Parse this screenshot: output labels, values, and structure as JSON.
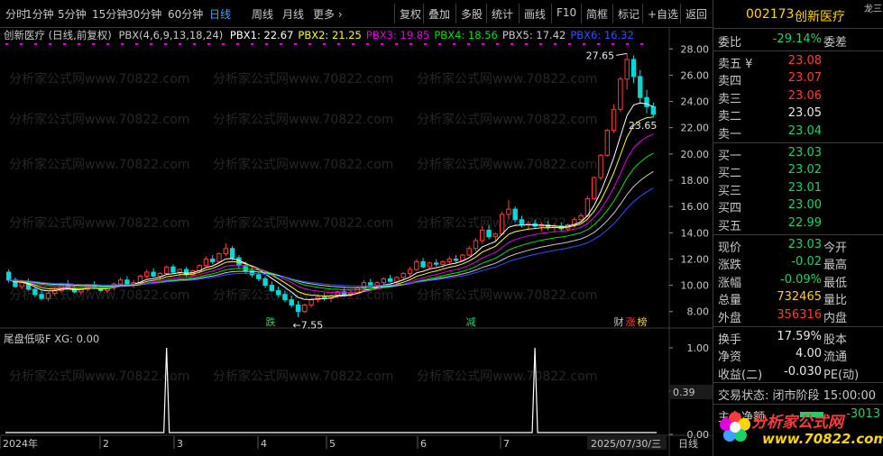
{
  "toolbar": {
    "periods": [
      "分时",
      "1分钟",
      "5分钟",
      "15分钟",
      "30分钟",
      "60分钟",
      "日线",
      "周线",
      "月线",
      "更多 ›"
    ],
    "active_period": "日线",
    "actions": [
      "复权",
      "叠加",
      "多股",
      "统计",
      "画线",
      "F10",
      "简框",
      "标记",
      "+自选",
      "返回"
    ]
  },
  "main_chart": {
    "title": "创新医疗 (日线,前复权)",
    "indicator_name": "PBX(4,6,9,13,18,24)",
    "indicators": [
      {
        "label": "PBX1: 22.67",
        "color": "#ffffff"
      },
      {
        "label": "PBX2: 21.25",
        "color": "#ffff00"
      },
      {
        "label": "PBX3: 19.85",
        "color": "#e000e0"
      },
      {
        "label": "PBX4: 18.56",
        "color": "#00e000"
      },
      {
        "label": "PBX5: 17.42",
        "color": "#c8c8c8"
      },
      {
        "label": "PBX6: 16.32",
        "color": "#3050ff"
      }
    ],
    "y_ticks": [
      "28.00",
      "26.00",
      "24.00",
      "22.00",
      "20.00",
      "18.00",
      "16.00",
      "14.00",
      "12.00",
      "10.00",
      "8.00"
    ],
    "high_label": "27.65",
    "close_label": "23.65",
    "low_label": "←7.55",
    "markers": [
      {
        "text": "跌",
        "color": "#19d36a"
      },
      {
        "text": "减",
        "color": "#19d36a"
      },
      {
        "text": "财",
        "color": "#c8c8c8"
      },
      {
        "text": "涨",
        "color": "#ff3b3b"
      },
      {
        "text": "榜",
        "color": "#ffd400"
      }
    ]
  },
  "sub_chart": {
    "title": "尾盘低吸F",
    "value_label": "XG: 0.00",
    "y_ticks": [
      "1.00",
      "0.50",
      "0.00"
    ],
    "marker_value": "0.39"
  },
  "x_axis": {
    "labels": [
      "2024年",
      "2",
      "3",
      "4",
      "5",
      "6",
      "7",
      "2025/07/30/三"
    ],
    "corner_label": "日线"
  },
  "watermark": "分析家公式网www.70822.com",
  "side_panel": {
    "code": "002173",
    "name": "创新医疗",
    "corner_tag": "龙三",
    "weibi": {
      "label": "委比",
      "value": "-29.14%",
      "right": "委差"
    },
    "asks": [
      {
        "label": "卖五 ¥",
        "price": "23.08",
        "color": "#ff3b3b"
      },
      {
        "label": "卖四",
        "price": "23.07",
        "color": "#ff3b3b"
      },
      {
        "label": "卖三",
        "price": "23.06",
        "color": "#ff3b3b"
      },
      {
        "label": "卖二",
        "price": "23.05",
        "color": "#e8e8e8"
      },
      {
        "label": "卖一",
        "price": "23.04",
        "color": "#19d36a"
      }
    ],
    "bids": [
      {
        "label": "买一",
        "price": "23.03",
        "color": "#19d36a"
      },
      {
        "label": "买二",
        "price": "23.02",
        "color": "#19d36a"
      },
      {
        "label": "买三",
        "price": "23.01",
        "color": "#19d36a"
      },
      {
        "label": "买四",
        "price": "23.00",
        "color": "#19d36a"
      },
      {
        "label": "买五",
        "price": "22.99",
        "color": "#19d36a"
      }
    ],
    "quote": [
      {
        "label": "现价",
        "value": "23.03",
        "color": "#19d36a",
        "right": "今开"
      },
      {
        "label": "涨跌",
        "value": "-0.02",
        "color": "#19d36a",
        "right": "最高"
      },
      {
        "label": "涨幅",
        "value": "-0.09%",
        "color": "#19d36a",
        "right": "最低"
      },
      {
        "label": "总量",
        "value": "732465",
        "color": "#ffd400",
        "right": "量比"
      },
      {
        "label": "外盘",
        "value": "356316",
        "color": "#ff3b3b",
        "right": "内盘"
      }
    ],
    "finance": [
      {
        "label": "换手",
        "value": "17.59%",
        "color": "#e8e8e8",
        "right": "股本"
      },
      {
        "label": "净资",
        "value": "4.00",
        "color": "#e8e8e8",
        "right": "流通"
      },
      {
        "label": "收益(二)",
        "value": "-0.030",
        "color": "#e8e8e8",
        "right": "PE(动)"
      }
    ],
    "status": "交易状态: 闭市阶段 15:00:00",
    "main_flow_label": "主力净额",
    "main_flow_value": "-3013"
  },
  "logo": {
    "line1": "分析家公式网",
    "line2": "www.70822.com"
  },
  "chart_data": {
    "type": "candlestick",
    "ylim": [
      7.5,
      28.5
    ],
    "ohlc": [
      [
        11.0,
        11.2,
        10.2,
        10.4
      ],
      [
        10.4,
        10.6,
        9.8,
        9.9
      ],
      [
        9.9,
        10.3,
        9.7,
        10.2
      ],
      [
        10.2,
        10.5,
        9.6,
        9.7
      ],
      [
        9.7,
        9.9,
        9.1,
        9.3
      ],
      [
        9.3,
        9.6,
        8.9,
        9.0
      ],
      [
        9.0,
        9.5,
        8.8,
        9.4
      ],
      [
        9.4,
        9.8,
        9.2,
        9.6
      ],
      [
        9.6,
        10.2,
        9.4,
        10.0
      ],
      [
        10.0,
        10.4,
        9.7,
        9.8
      ],
      [
        9.8,
        10.0,
        9.4,
        9.5
      ],
      [
        9.5,
        9.8,
        9.3,
        9.7
      ],
      [
        9.7,
        10.1,
        9.5,
        10.0
      ],
      [
        10.0,
        10.3,
        9.7,
        9.8
      ],
      [
        9.8,
        10.0,
        9.5,
        9.6
      ],
      [
        9.6,
        9.9,
        9.4,
        9.8
      ],
      [
        9.8,
        10.2,
        9.6,
        10.1
      ],
      [
        10.1,
        10.6,
        9.9,
        10.4
      ],
      [
        10.4,
        10.7,
        10.0,
        10.1
      ],
      [
        10.1,
        10.4,
        9.8,
        10.2
      ],
      [
        10.2,
        10.8,
        10.1,
        10.7
      ],
      [
        10.7,
        11.2,
        10.5,
        11.0
      ],
      [
        11.0,
        11.3,
        10.6,
        10.7
      ],
      [
        10.7,
        11.0,
        10.4,
        10.9
      ],
      [
        10.9,
        11.5,
        10.8,
        11.4
      ],
      [
        11.4,
        11.6,
        10.9,
        11.0
      ],
      [
        11.0,
        11.3,
        10.7,
        11.2
      ],
      [
        11.2,
        11.4,
        10.6,
        10.8
      ],
      [
        10.8,
        11.2,
        10.7,
        11.1
      ],
      [
        11.1,
        11.6,
        11.0,
        11.5
      ],
      [
        11.5,
        12.2,
        11.4,
        12.0
      ],
      [
        12.0,
        12.3,
        11.6,
        11.8
      ],
      [
        11.8,
        12.5,
        11.7,
        12.4
      ],
      [
        12.4,
        13.2,
        12.2,
        12.8
      ],
      [
        12.8,
        13.0,
        11.9,
        12.1
      ],
      [
        12.1,
        12.3,
        11.3,
        11.5
      ],
      [
        11.5,
        11.8,
        10.9,
        11.1
      ],
      [
        11.1,
        11.4,
        10.6,
        10.8
      ],
      [
        10.8,
        11.0,
        10.3,
        10.5
      ],
      [
        10.5,
        10.7,
        9.8,
        10.0
      ],
      [
        10.0,
        10.3,
        9.5,
        9.6
      ],
      [
        9.6,
        9.9,
        9.1,
        9.3
      ],
      [
        9.3,
        9.6,
        8.7,
        8.9
      ],
      [
        8.9,
        9.2,
        8.3,
        8.5
      ],
      [
        8.5,
        8.8,
        7.55,
        8.0
      ],
      [
        8.0,
        8.6,
        7.9,
        8.5
      ],
      [
        8.5,
        9.0,
        8.3,
        8.9
      ],
      [
        8.9,
        9.3,
        8.7,
        9.1
      ],
      [
        9.1,
        9.4,
        8.8,
        9.0
      ],
      [
        9.0,
        9.3,
        8.7,
        9.2
      ],
      [
        9.2,
        9.6,
        9.0,
        9.5
      ],
      [
        9.5,
        9.8,
        9.2,
        9.3
      ],
      [
        9.3,
        9.6,
        9.1,
        9.4
      ],
      [
        9.4,
        9.9,
        9.3,
        9.8
      ],
      [
        9.8,
        10.4,
        9.7,
        10.2
      ],
      [
        10.2,
        10.5,
        9.9,
        10.0
      ],
      [
        10.0,
        10.3,
        9.8,
        10.2
      ],
      [
        10.2,
        10.6,
        10.0,
        10.5
      ],
      [
        10.5,
        10.8,
        10.2,
        10.3
      ],
      [
        10.3,
        10.7,
        10.1,
        10.6
      ],
      [
        10.6,
        11.0,
        10.4,
        10.9
      ],
      [
        10.9,
        11.4,
        10.7,
        11.2
      ],
      [
        11.2,
        12.0,
        11.1,
        11.8
      ],
      [
        11.8,
        12.1,
        11.3,
        11.4
      ],
      [
        11.4,
        11.8,
        11.2,
        11.7
      ],
      [
        11.7,
        12.0,
        11.4,
        11.6
      ],
      [
        11.6,
        11.9,
        11.3,
        11.8
      ],
      [
        11.8,
        12.2,
        11.6,
        12.0
      ],
      [
        12.0,
        12.3,
        11.7,
        11.9
      ],
      [
        11.9,
        12.4,
        11.8,
        12.3
      ],
      [
        12.3,
        13.0,
        12.2,
        12.8
      ],
      [
        12.8,
        13.6,
        12.6,
        13.4
      ],
      [
        13.4,
        14.5,
        13.2,
        14.2
      ],
      [
        14.2,
        14.6,
        13.5,
        13.7
      ],
      [
        13.7,
        14.0,
        13.3,
        13.9
      ],
      [
        13.9,
        15.6,
        13.8,
        15.4
      ],
      [
        15.4,
        16.5,
        15.0,
        15.8
      ],
      [
        15.8,
        16.0,
        14.8,
        15.0
      ],
      [
        15.0,
        15.3,
        14.4,
        14.6
      ],
      [
        14.6,
        14.9,
        14.2,
        14.7
      ],
      [
        14.7,
        15.0,
        14.3,
        14.5
      ],
      [
        14.5,
        14.8,
        14.1,
        14.6
      ],
      [
        14.6,
        14.9,
        14.2,
        14.4
      ],
      [
        14.4,
        14.7,
        14.0,
        14.5
      ],
      [
        14.5,
        14.8,
        14.1,
        14.3
      ],
      [
        14.3,
        14.7,
        14.1,
        14.6
      ],
      [
        14.6,
        15.2,
        14.4,
        15.0
      ],
      [
        15.0,
        15.5,
        14.8,
        15.3
      ],
      [
        15.3,
        16.8,
        15.2,
        16.6
      ],
      [
        16.6,
        18.3,
        16.5,
        18.2
      ],
      [
        18.2,
        20.0,
        18.0,
        19.9
      ],
      [
        19.9,
        21.9,
        19.8,
        21.8
      ],
      [
        21.8,
        23.8,
        21.6,
        23.4
      ],
      [
        23.4,
        25.9,
        23.2,
        25.7
      ],
      [
        25.7,
        27.65,
        24.9,
        27.2
      ],
      [
        27.2,
        27.5,
        25.4,
        25.9
      ],
      [
        25.9,
        26.4,
        23.8,
        24.3
      ],
      [
        24.3,
        24.9,
        23.1,
        23.6
      ],
      [
        23.6,
        23.9,
        22.8,
        23.03
      ]
    ],
    "signals_sub": [
      0,
      0,
      0,
      0,
      0,
      0,
      0,
      0,
      0,
      0,
      0,
      0,
      0,
      0,
      0,
      0,
      0,
      0,
      0,
      0,
      0,
      0,
      0,
      0,
      0,
      0,
      0,
      0,
      0,
      0,
      0,
      0,
      0,
      0,
      0,
      0,
      0,
      0,
      0,
      0,
      0,
      0,
      0,
      0,
      0,
      0,
      0,
      0,
      0,
      0,
      0,
      0,
      0,
      0,
      0,
      0,
      0,
      0,
      0,
      0,
      0,
      0,
      0,
      0,
      0,
      0,
      0,
      0,
      0,
      0,
      0,
      0,
      0,
      0,
      0,
      0,
      0,
      0,
      0,
      0,
      0,
      0,
      0,
      0,
      0,
      0,
      0,
      0,
      0,
      0,
      0,
      0,
      0,
      0,
      0,
      0,
      0,
      0,
      0
    ],
    "signal_days": [
      24,
      80
    ]
  }
}
